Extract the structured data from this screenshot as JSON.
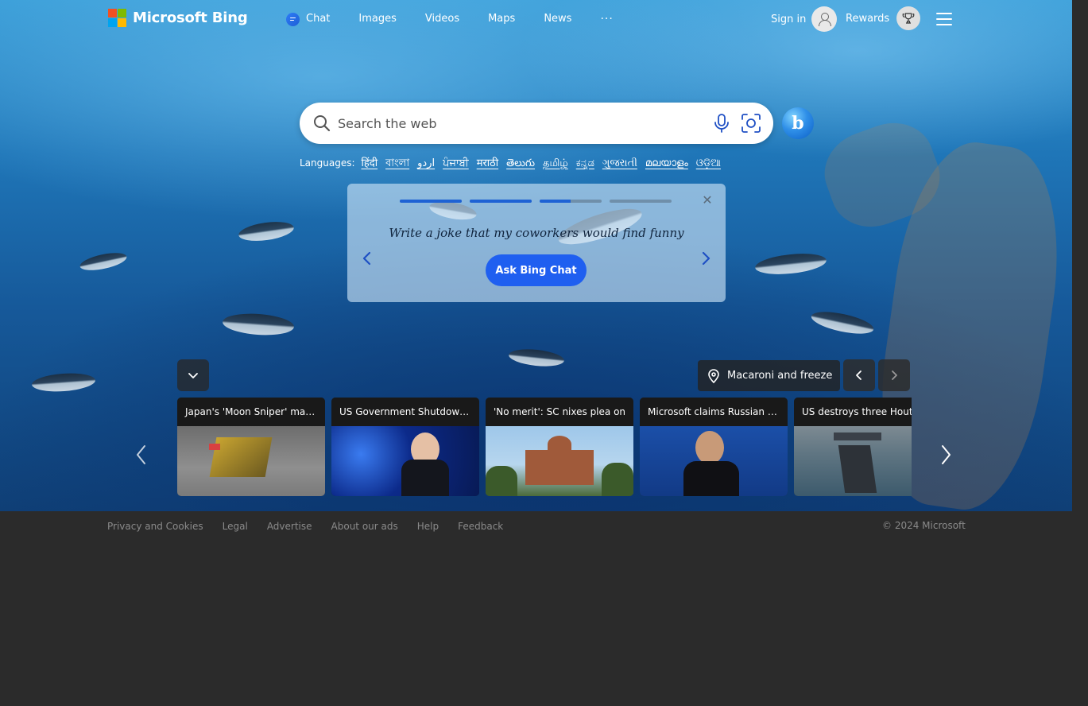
{
  "header": {
    "brand": "Microsoft Bing",
    "nav": [
      {
        "label": "Chat",
        "icon": "chat-bubble-icon"
      },
      {
        "label": "Images"
      },
      {
        "label": "Videos"
      },
      {
        "label": "Maps"
      },
      {
        "label": "News"
      }
    ],
    "more": "···",
    "sign_in": "Sign in",
    "rewards": "Rewards"
  },
  "search": {
    "placeholder": "Search the web"
  },
  "languages": {
    "label": "Languages:",
    "items": [
      "हिंदी",
      "বাংলা",
      "اردو",
      "ਪੰਜਾਬੀ",
      "मराठी",
      "తెలుగు",
      "தமிழ்",
      "ಕನ್ನಡ",
      "ગુજરાતી",
      "മലയാളം",
      "ଓଡ଼ିଆ"
    ]
  },
  "promo": {
    "text": "Write a joke that my coworkers would find funny",
    "button": "Ask Bing Chat",
    "progress": [
      1,
      1,
      0.5,
      0
    ]
  },
  "image_info": {
    "location": "Macaroni and freeze"
  },
  "news": [
    {
      "title": "Japan's 'Moon Sniper' makes"
    },
    {
      "title": "US Government Shutdown Updates"
    },
    {
      "title": "'No merit': SC nixes plea on"
    },
    {
      "title": "Microsoft claims Russian state"
    },
    {
      "title": "US destroys three Houthi"
    }
  ],
  "footer": {
    "links": [
      "Privacy and Cookies",
      "Legal",
      "Advertise",
      "About our ads",
      "Help",
      "Feedback"
    ],
    "copyright": "© 2024 Microsoft"
  },
  "colors": {
    "accent": "#1f5ff0",
    "footer_bg": "#2b2b2b"
  }
}
